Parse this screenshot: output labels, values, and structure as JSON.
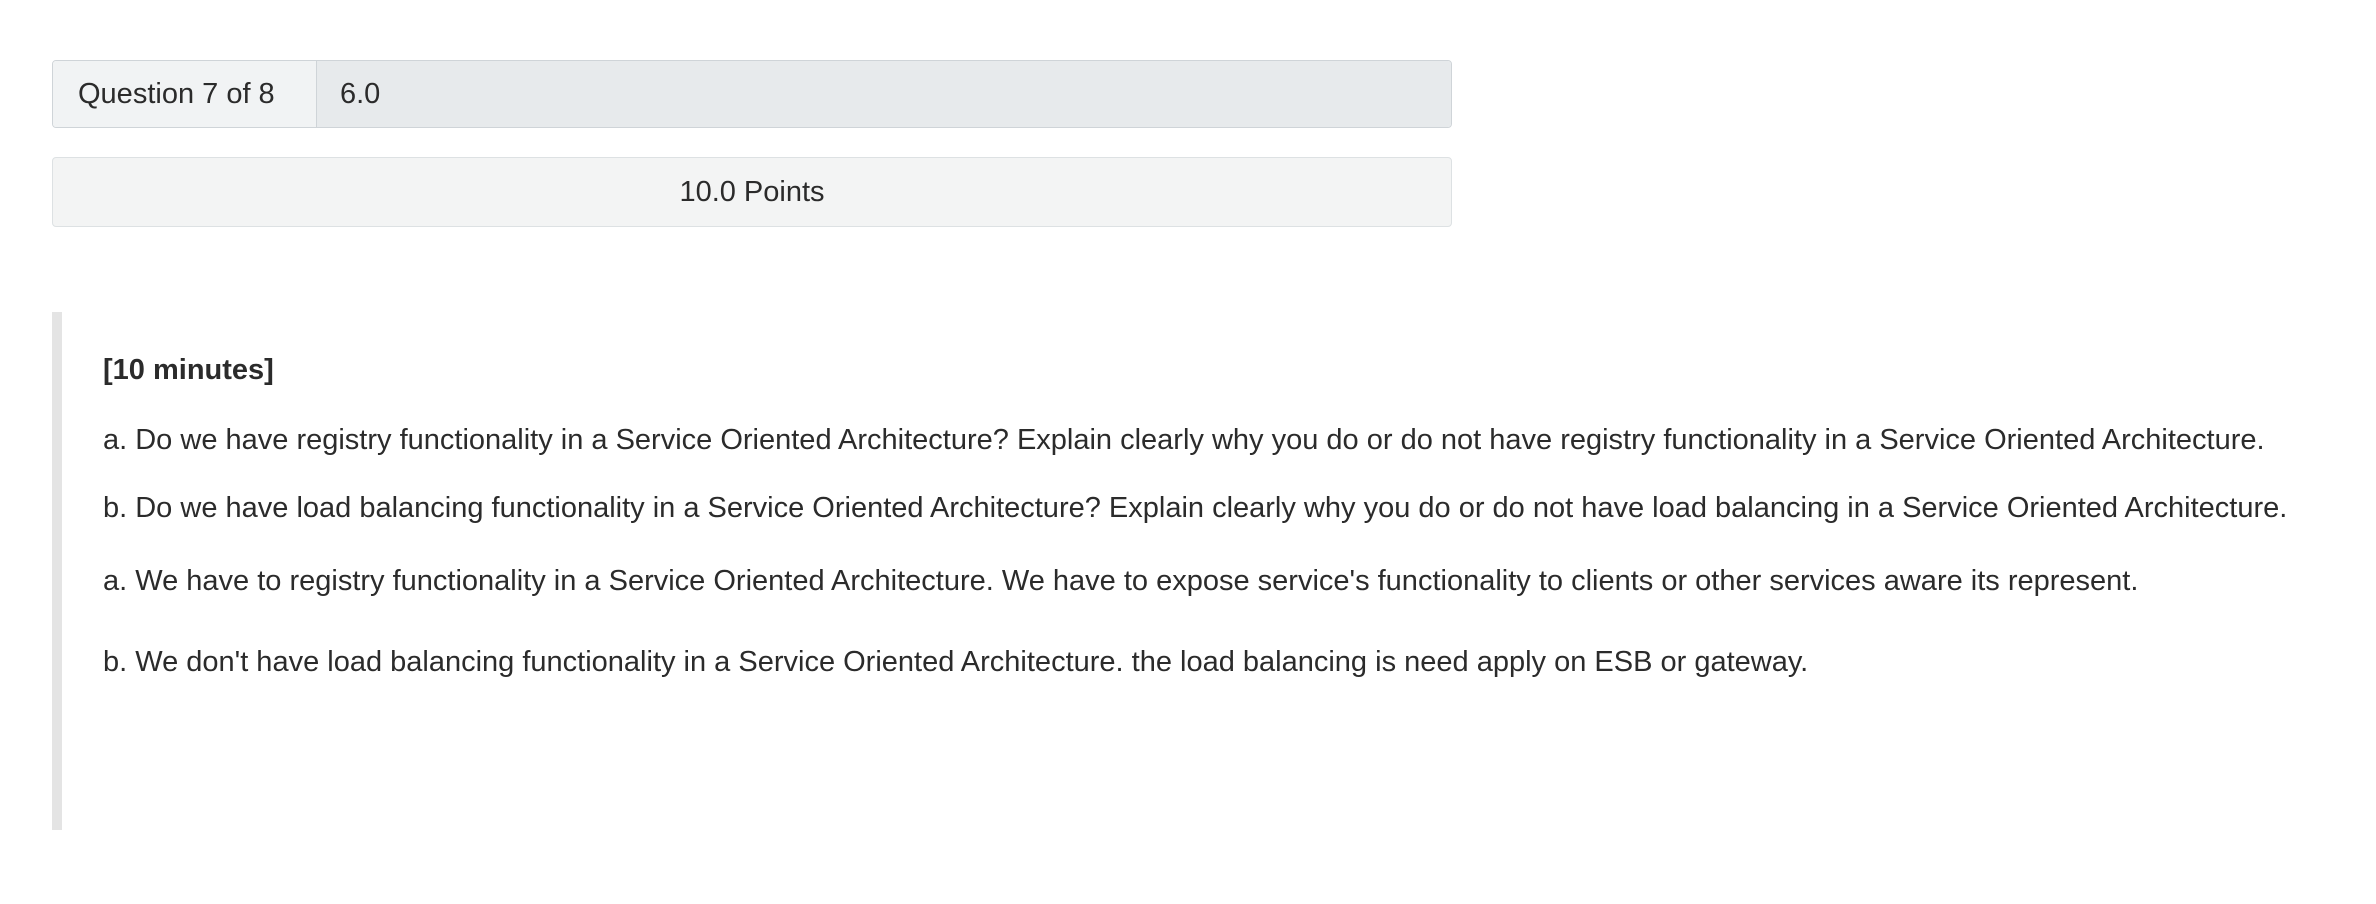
{
  "question": {
    "counter": "Question 7 of 8",
    "score": "6.0",
    "points": "10.0 Points"
  },
  "prompt": {
    "time_limit": "[10 minutes]",
    "part_a": "a. Do we have registry functionality in a Service Oriented Architecture? Explain clearly why you do or do not have registry functionality in a Service Oriented Architecture.",
    "part_b": "b. Do we have load balancing functionality in a Service Oriented Architecture? Explain clearly why you do or do not have load balancing in a Service Oriented Architecture."
  },
  "answer": {
    "part_a": "a. We have to registry functionality in a Service Oriented Architecture. We have to expose service's functionality to clients or other services aware its represent.",
    "part_b": "b. We don't have load balancing functionality in a Service Oriented Architecture. the load balancing is need apply on ESB or gateway."
  }
}
